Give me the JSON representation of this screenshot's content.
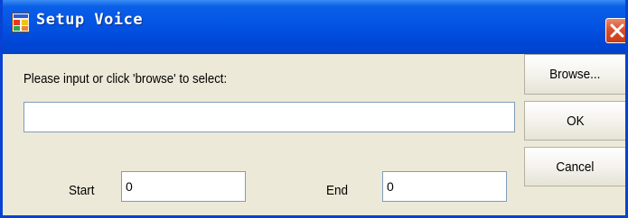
{
  "window": {
    "title": "Setup Voice",
    "icon": "app-window-icon",
    "close_icon": "close-icon"
  },
  "form": {
    "prompt": "Please input or click 'browse' to select:",
    "path_value": "",
    "start_label": "Start",
    "start_value": "0",
    "end_label": "End",
    "end_value": "0"
  },
  "buttons": {
    "browse": "Browse...",
    "ok": "OK",
    "cancel": "Cancel"
  },
  "colors": {
    "titlebar": "#0354e3",
    "close": "#d9502e",
    "face": "#ece9d8",
    "input_border": "#7f9db9"
  }
}
